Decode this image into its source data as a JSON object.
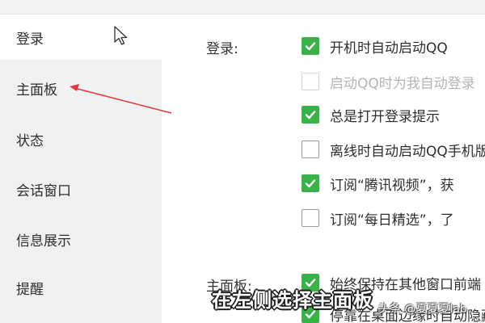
{
  "sidebar": {
    "items": [
      {
        "label": "登录",
        "active": true
      },
      {
        "label": "主面板",
        "active": false
      },
      {
        "label": "状态",
        "active": false
      },
      {
        "label": "会话窗口",
        "active": false
      },
      {
        "label": "信息展示",
        "active": false
      },
      {
        "label": "提醒",
        "active": false
      }
    ]
  },
  "main": {
    "login_section": {
      "label": "登录:",
      "options": [
        {
          "text": "开机时自动启动QQ",
          "checked": true,
          "disabled": false
        },
        {
          "text": "启动QQ时为我自动登录",
          "checked": false,
          "disabled": true
        },
        {
          "text": "总是打开登录提示",
          "checked": true,
          "disabled": false
        },
        {
          "text": "离线时自动启动QQ手机版",
          "checked": false,
          "disabled": false
        },
        {
          "text": "订阅“腾讯视频”，获",
          "checked": true,
          "disabled": false
        },
        {
          "text": "订阅“每日精选”，了",
          "checked": false,
          "disabled": false
        }
      ]
    },
    "panel_section": {
      "label": "主面板:",
      "options": [
        {
          "text": "始终保持在其他窗口前端",
          "checked": true,
          "disabled": false
        },
        {
          "text": "停靠在桌面边缘时自动隐藏",
          "checked": true,
          "disabled": false
        }
      ]
    }
  },
  "overlay": {
    "caption": "在左侧选择主面板",
    "watermark": "头条 @夏夏夏lab"
  },
  "colors": {
    "check_green": "#3bb14a",
    "annotation_red": "#e23a3a",
    "sidebar_bg": "#f0f1f3"
  },
  "icons": {
    "cursor": "mouse-pointer-icon",
    "checkmark": "checkmark-icon",
    "annotation": "red-arrow-annotation"
  }
}
